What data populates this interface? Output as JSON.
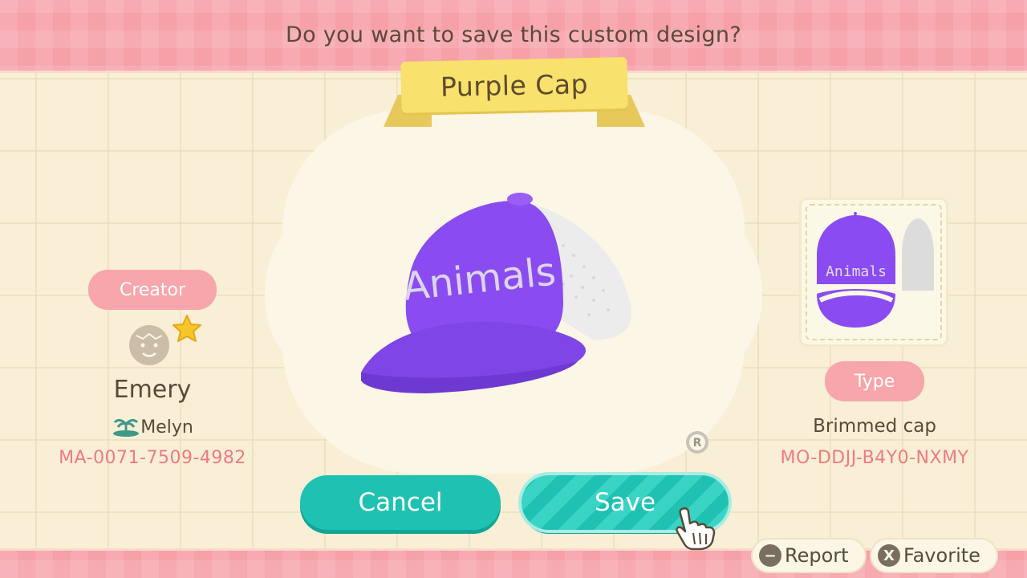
{
  "dialog": {
    "question": "Do you want to save this custom design?",
    "design_title": "Purple Cap"
  },
  "creator": {
    "label": "Creator",
    "name": "Emery",
    "island": "Melyn",
    "creator_code": "MA-0071-7509-4982"
  },
  "design": {
    "type_label": "Type",
    "type_value": "Brimmed cap",
    "design_code": "MO-DDJJ-B4Y0-NXMY",
    "cap_text": "Animals",
    "cap_color": "#8a4cf0"
  },
  "buttons": {
    "cancel": "Cancel",
    "save": "Save"
  },
  "prompts": {
    "report_key": "−",
    "report": "Report",
    "favorite_key": "X",
    "favorite": "Favorite"
  },
  "colors": {
    "accent_teal": "#1fc2b2",
    "pink": "#f6a0a8",
    "code_pink": "#f07a84",
    "banner_yellow": "#f8e16c"
  }
}
